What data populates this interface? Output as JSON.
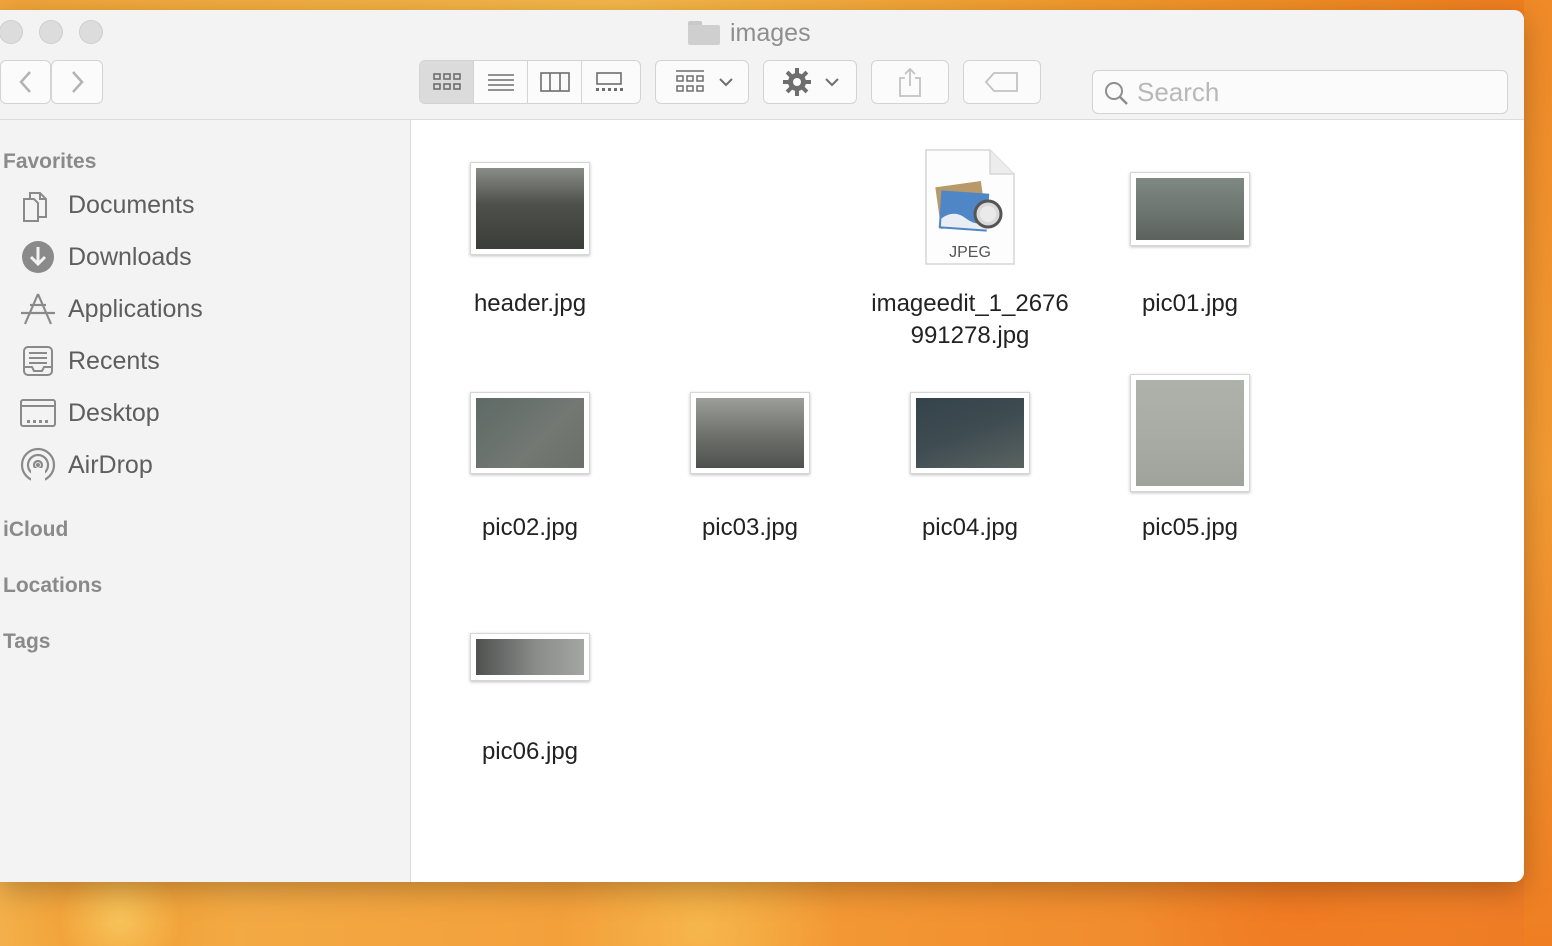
{
  "window": {
    "title": "images"
  },
  "toolbar": {
    "view_buttons": [
      "icon-view",
      "list-view",
      "column-view",
      "gallery-view"
    ],
    "active_view": "icon-view"
  },
  "search": {
    "placeholder": "Search",
    "value": ""
  },
  "sidebar": {
    "favorites_header": "Favorites",
    "items": [
      {
        "label": "Documents",
        "icon": "documents-icon"
      },
      {
        "label": "Downloads",
        "icon": "downloads-icon"
      },
      {
        "label": "Applications",
        "icon": "applications-icon"
      },
      {
        "label": "Recents",
        "icon": "recents-icon"
      },
      {
        "label": "Desktop",
        "icon": "desktop-icon"
      },
      {
        "label": "AirDrop",
        "icon": "airdrop-icon"
      }
    ],
    "icloud_header": "iCloud",
    "locations_header": "Locations",
    "tags_header": "Tags"
  },
  "files": [
    {
      "name": "header.jpg",
      "thumb_color": "#4e504c"
    },
    {
      "name": "imageedit_1_2676\n991278.jpg",
      "icon_label": "JPEG"
    },
    {
      "name": "pic01.jpg",
      "thumb_color": "#6f7771"
    },
    {
      "name": "pic02.jpg",
      "thumb_color": "#6b716c"
    },
    {
      "name": "pic03.jpg",
      "thumb_color": "#6d6f6b"
    },
    {
      "name": "pic04.jpg",
      "thumb_color": "#3f4c52"
    },
    {
      "name": "pic05.jpg",
      "thumb_color": "#a8aca4"
    },
    {
      "name": "pic06.jpg",
      "thumb_color": "#7b7d7b"
    }
  ]
}
